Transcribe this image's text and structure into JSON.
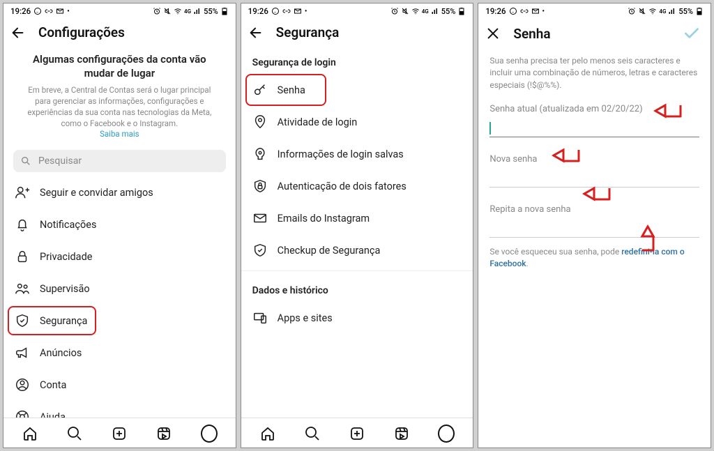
{
  "status": {
    "time": "19:26",
    "battery": "55%"
  },
  "screen1": {
    "title": "Configurações",
    "banner_title": "Algumas configurações da conta vão mudar de lugar",
    "banner_desc": "Em breve, a Central de Contas será o lugar principal para gerenciar as informações, configurações e experiências da sua conta nas tecnologias da Meta, como o Facebook e o Instagram.",
    "banner_link": "Saiba mais",
    "search_placeholder": "Pesquisar",
    "menu": {
      "follow_invite": "Seguir e convidar amigos",
      "notifications": "Notificações",
      "privacy": "Privacidade",
      "supervision": "Supervisão",
      "security": "Segurança",
      "ads": "Anúncios",
      "account": "Conta",
      "help": "Ajuda"
    }
  },
  "screen2": {
    "title": "Segurança",
    "section_login": "Segurança de login",
    "items": {
      "password": "Senha",
      "login_activity": "Atividade de login",
      "saved_login": "Informações de login salvas",
      "two_factor": "Autenticação de dois fatores",
      "emails": "Emails do Instagram",
      "checkup": "Checkup de Segurança"
    },
    "section_data": "Dados e histórico",
    "apps_sites": "Apps e sites"
  },
  "screen3": {
    "title": "Senha",
    "desc": "Sua senha precisa ter pelo menos seis caracteres e incluir uma combinação de números, letras e caracteres especiais (!$@%%).",
    "current_label": "Senha atual (atualizada em 02/20/22)",
    "new_label": "Nova senha",
    "repeat_label": "Repita a nova senha",
    "forgot_text": "Se você esqueceu sua senha, pode ",
    "forgot_link": "redefini-la com o Facebook"
  }
}
